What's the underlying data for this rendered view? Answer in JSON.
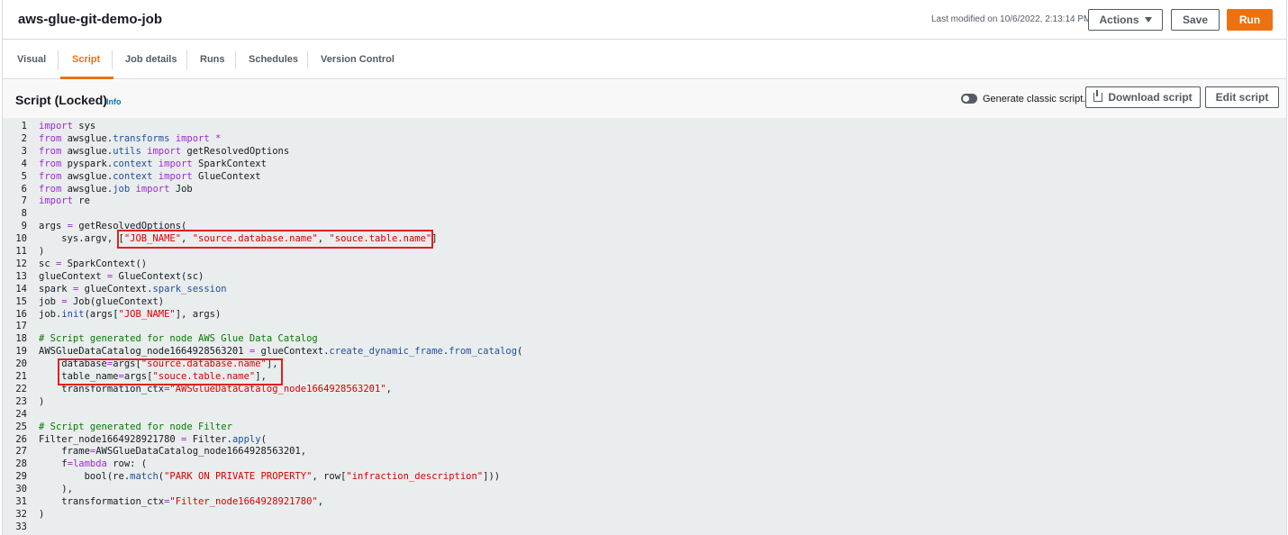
{
  "header": {
    "job_title": "aws-glue-git-demo-job",
    "last_modified": "Last modified on 10/6/2022, 2:13:14 PM",
    "actions_label": "Actions",
    "save_label": "Save",
    "run_label": "Run"
  },
  "tabs": [
    {
      "label": "Visual"
    },
    {
      "label": "Script"
    },
    {
      "label": "Job details"
    },
    {
      "label": "Runs"
    },
    {
      "label": "Schedules"
    },
    {
      "label": "Version Control"
    }
  ],
  "active_tab": "Script",
  "script_section": {
    "title": "Script (Locked)",
    "info_label": "Info",
    "toggle_label": "Generate classic script.",
    "toggle_state": "off",
    "download_label": "Download script",
    "edit_label": "Edit script"
  },
  "colors": {
    "accent": "#ec7211",
    "link": "#0073bb",
    "highlight_box": "#e02020"
  },
  "code_lines": [
    "import sys",
    "from awsglue.transforms import *",
    "from awsglue.utils import getResolvedOptions",
    "from pyspark.context import SparkContext",
    "from awsglue.context import GlueContext",
    "from awsglue.job import Job",
    "import re",
    "",
    "args = getResolvedOptions(",
    "    sys.argv, [\"JOB_NAME\", \"source.database.name\", \"souce.table.name\"]",
    ")",
    "sc = SparkContext()",
    "glueContext = GlueContext(sc)",
    "spark = glueContext.spark_session",
    "job = Job(glueContext)",
    "job.init(args[\"JOB_NAME\"], args)",
    "",
    "# Script generated for node AWS Glue Data Catalog",
    "AWSGlueDataCatalog_node1664928563201 = glueContext.create_dynamic_frame.from_catalog(",
    "    database=args[\"source.database.name\"],",
    "    table_name=args[\"souce.table.name\"],",
    "    transformation_ctx=\"AWSGlueDataCatalog_node1664928563201\",",
    ")",
    "",
    "# Script generated for node Filter",
    "Filter_node1664928921780 = Filter.apply(",
    "    frame=AWSGlueDataCatalog_node1664928563201,",
    "    f=lambda row: (",
    "        bool(re.match(\"PARK ON PRIVATE PROPERTY\", row[\"infraction_description\"]))",
    "    ),",
    "    transformation_ctx=\"Filter_node1664928921780\",",
    ")",
    ""
  ]
}
